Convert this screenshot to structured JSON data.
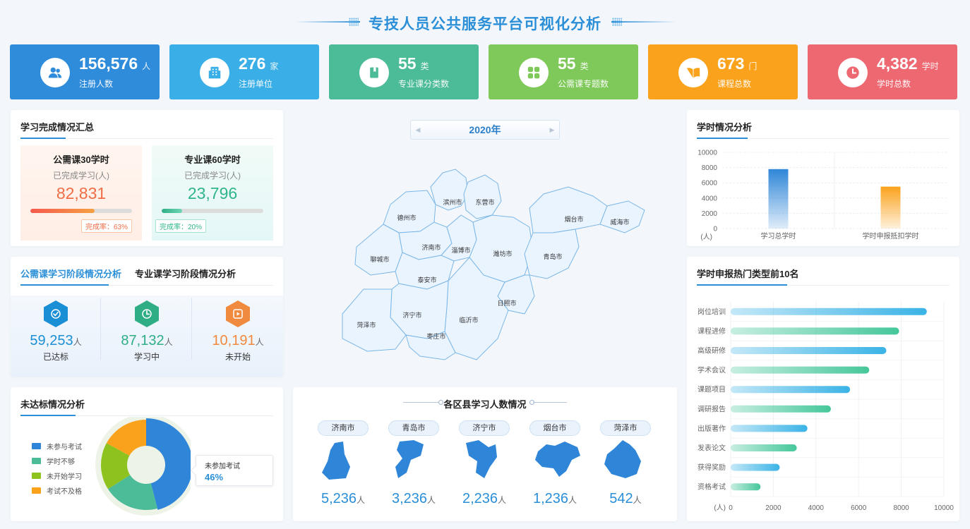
{
  "page": {
    "title": "专技人员公共服务平台可视化分析"
  },
  "stats": [
    {
      "value": "156,576",
      "unit": "人",
      "label": "注册人数",
      "color": "#2f8cdb",
      "icon": "users-icon"
    },
    {
      "value": "276",
      "unit": "家",
      "label": "注册单位",
      "color": "#3aaee6",
      "icon": "building-icon"
    },
    {
      "value": "55",
      "unit": "类",
      "label": "专业课分类数",
      "color": "#4cbb97",
      "icon": "book-icon"
    },
    {
      "value": "55",
      "unit": "类",
      "label": "公需课专题数",
      "color": "#7fc95a",
      "icon": "grid-icon"
    },
    {
      "value": "673",
      "unit": "门",
      "label": "课程总数",
      "color": "#fba21c",
      "icon": "open-book-icon"
    },
    {
      "value": "4,382",
      "unit": "学时",
      "label": "学时总数",
      "color": "#ee6872",
      "icon": "clock-icon"
    }
  ],
  "completion": {
    "title": "学习完成情况汇总",
    "items": [
      {
        "name": "公需课30学时",
        "sub": "已完成学习(人)",
        "value": "82,831",
        "rate_label": "完成率：63%",
        "rate": 0.63,
        "color": "#f06d46"
      },
      {
        "name": "专业课60学时",
        "sub": "已完成学习(人)",
        "value": "23,796",
        "rate_label": "完成率：20%",
        "rate": 0.2,
        "color": "#2fb58b"
      }
    ]
  },
  "stage": {
    "tabs": [
      "公需课学习阶段情况分析",
      "专业课学习阶段情况分析"
    ],
    "items": [
      {
        "value": "59,253",
        "unit": "人",
        "label": "已达标",
        "color": "#1b8fd6",
        "icon": "badge-check-icon"
      },
      {
        "value": "87,132",
        "unit": "人",
        "label": "学习中",
        "color": "#2fae85",
        "icon": "clock-icon"
      },
      {
        "value": "10,191",
        "unit": "人",
        "label": "未开始",
        "color": "#f08a3e",
        "icon": "play-icon"
      }
    ]
  },
  "unmet": {
    "title": "未达标情况分析",
    "tooltip_label": "未参加考试",
    "tooltip_value": "46%"
  },
  "map": {
    "year": "2020年",
    "cities": [
      "滨州市",
      "东营市",
      "德州市",
      "烟台市",
      "威海市",
      "济南市",
      "淄博市",
      "潍坊市",
      "青岛市",
      "聊城市",
      "泰安市",
      "日照市",
      "济宁市",
      "临沂市",
      "菏泽市",
      "枣庄市"
    ]
  },
  "district": {
    "title": "各区县学习人数情况",
    "items": [
      {
        "city": "济南市",
        "value": "5,236",
        "unit": "人"
      },
      {
        "city": "青岛市",
        "value": "3,236",
        "unit": "人"
      },
      {
        "city": "济宁市",
        "value": "2,236",
        "unit": "人"
      },
      {
        "city": "烟台市",
        "value": "1,236",
        "unit": "人"
      },
      {
        "city": "菏泽市",
        "value": "542",
        "unit": "人"
      }
    ]
  },
  "hours_panel": {
    "title": "学时情况分析"
  },
  "top10_panel": {
    "title": "学时申报热门类型前10名"
  },
  "chart_data": [
    {
      "type": "bar",
      "title": "学时情况分析",
      "categories": [
        "学习总学时",
        "学时申报抵扣学时"
      ],
      "values": [
        7800,
        5500
      ],
      "ylabel": "(人)",
      "ylim": [
        0,
        10000
      ],
      "yticks": [
        0,
        2000,
        4000,
        6000,
        8000,
        10000
      ],
      "colors": [
        "#2f86d8",
        "#fba21c"
      ],
      "grid": true
    },
    {
      "type": "bar",
      "orientation": "horizontal",
      "title": "学时申报热门类型前10名",
      "categories": [
        "岗位培训",
        "课程进修",
        "高级研修",
        "学术会议",
        "课题项目",
        "调研报告",
        "出版著作",
        "发表论文",
        "获得奖励",
        "资格考试"
      ],
      "values": [
        9200,
        7900,
        7300,
        6500,
        5600,
        4700,
        3600,
        3100,
        2300,
        1400
      ],
      "xlabel": "(人)",
      "xlim": [
        0,
        10000
      ],
      "xticks": [
        0,
        2000,
        4000,
        6000,
        8000,
        10000
      ],
      "colors": [
        "#3ab3e6",
        "#45c79a"
      ],
      "grid": true
    },
    {
      "type": "pie",
      "title": "未达标情况分析",
      "categories": [
        "未参与考试",
        "学时不够",
        "未开始学习",
        "考试不及格"
      ],
      "values": [
        46,
        20,
        17,
        17
      ],
      "colors": [
        "#2f86d8",
        "#4cbb97",
        "#8dc21f",
        "#fba21c"
      ],
      "legend": "left"
    }
  ]
}
